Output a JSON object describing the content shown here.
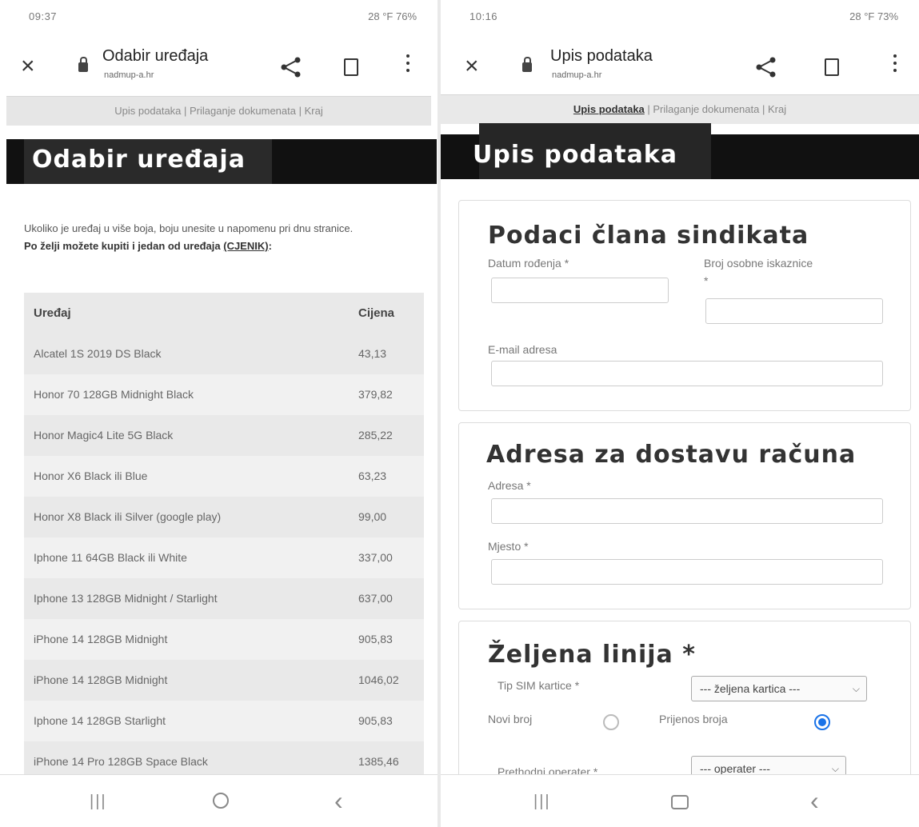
{
  "left": {
    "status": {
      "time": "09:37",
      "right": "28 °F 76%"
    },
    "toolbar": {
      "title": "Odabir uređaja",
      "url": "nadmup-a.hr"
    },
    "breadcrumb": "Upis podataka | Prilaganje dokumenata | Kraj",
    "banner_title": "Odabir uređaja",
    "intro": {
      "line1": "Ukoliko je uređaj u više boja, boju unesite u napomenu pri dnu stranice.",
      "line2": "Po želji možete kupiti i jedan od uređaja",
      "link": "(CJENIK)",
      "colon": ":"
    },
    "table": {
      "headers": {
        "device": "Uređaj",
        "price": "Cijena"
      },
      "rows": [
        {
          "device": "Alcatel 1S 2019 DS Black",
          "price": "43,13"
        },
        {
          "device": "Honor 70 128GB Midnight Black",
          "price": "379,82"
        },
        {
          "device": "Honor Magic4 Lite 5G Black",
          "price": "285,22"
        },
        {
          "device": "Honor X6 Black ili Blue",
          "price": "63,23"
        },
        {
          "device": "Honor X8 Black ili Silver (google play)",
          "price": "99,00"
        },
        {
          "device": "Iphone 11 64GB Black ili White",
          "price": "337,00"
        },
        {
          "device": "Iphone 13 128GB Midnight / Starlight",
          "price": "637,00"
        },
        {
          "device": "iPhone 14 128GB Midnight",
          "price": "905,83"
        },
        {
          "device": "iPhone 14 128GB Midnight",
          "price": "1046,02"
        },
        {
          "device": "Iphone 14 128GB Starlight",
          "price": "905,83"
        },
        {
          "device": "iPhone 14 Pro 128GB Space Black",
          "price": "1385,46"
        }
      ]
    }
  },
  "right": {
    "status": {
      "time": "10:16",
      "right": "28 °F 73%"
    },
    "toolbar": {
      "title": "Upis podataka",
      "url": "nadmup-a.hr"
    },
    "breadcrumb": {
      "active": "Upis podataka",
      "rest": " | Prilaganje dokumenata | Kraj"
    },
    "banner_title": "Upis podataka",
    "member": {
      "title": "Podaci člana sindikata",
      "dob_label": "Datum rođenja *",
      "id_label_1": "Broj osobne iskaznice",
      "id_label_2": "*",
      "email_label": "E-mail adresa"
    },
    "address": {
      "title": "Adresa za dostavu računa",
      "address_label": "Adresa *",
      "city_label": "Mjesto *"
    },
    "line": {
      "title": "Željena linija *",
      "sim_label": "Tip SIM kartice *",
      "sim_select": "--- željena kartica ---",
      "new_number": "Novi broj",
      "port_number": "Prijenos broja",
      "operator_label": "Prethodni operater *",
      "operator_select": "--- operater ---"
    }
  }
}
